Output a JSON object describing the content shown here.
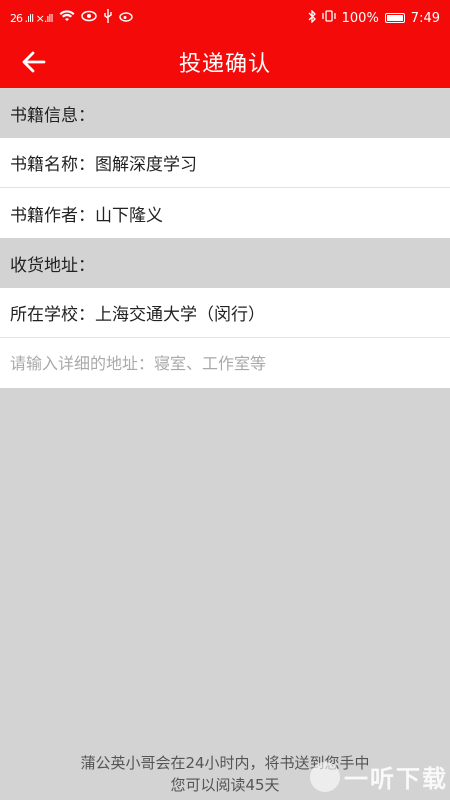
{
  "status_bar": {
    "signal_text": "26 .ıll ×.ıll",
    "icons": [
      "wifi-icon",
      "eye-icon",
      "usb-icon",
      "weibo-icon"
    ],
    "right_icons": [
      "bluetooth-icon",
      "vibrate-icon"
    ],
    "battery_percent": "100%",
    "time": "7:49"
  },
  "app_bar": {
    "title": "投递确认",
    "back_icon": "arrow-left-icon",
    "background_color": "#f50a0a"
  },
  "book_info": {
    "header": "书籍信息：",
    "name_label": "书籍名称：",
    "name_value": "图解深度学习",
    "author_label": "书籍作者：",
    "author_value": "山下隆义"
  },
  "shipping": {
    "header": "收货地址：",
    "school_label": "所在学校：",
    "school_value": "上海交通大学（闵行）",
    "address_placeholder": "请输入详细的地址：寝室、工作室等",
    "address_value": ""
  },
  "footer": {
    "line1": "蒲公英小哥会在24小时内，将书送到您手中",
    "line2": "您可以阅读45天"
  },
  "watermark": {
    "text": "一听下载"
  }
}
